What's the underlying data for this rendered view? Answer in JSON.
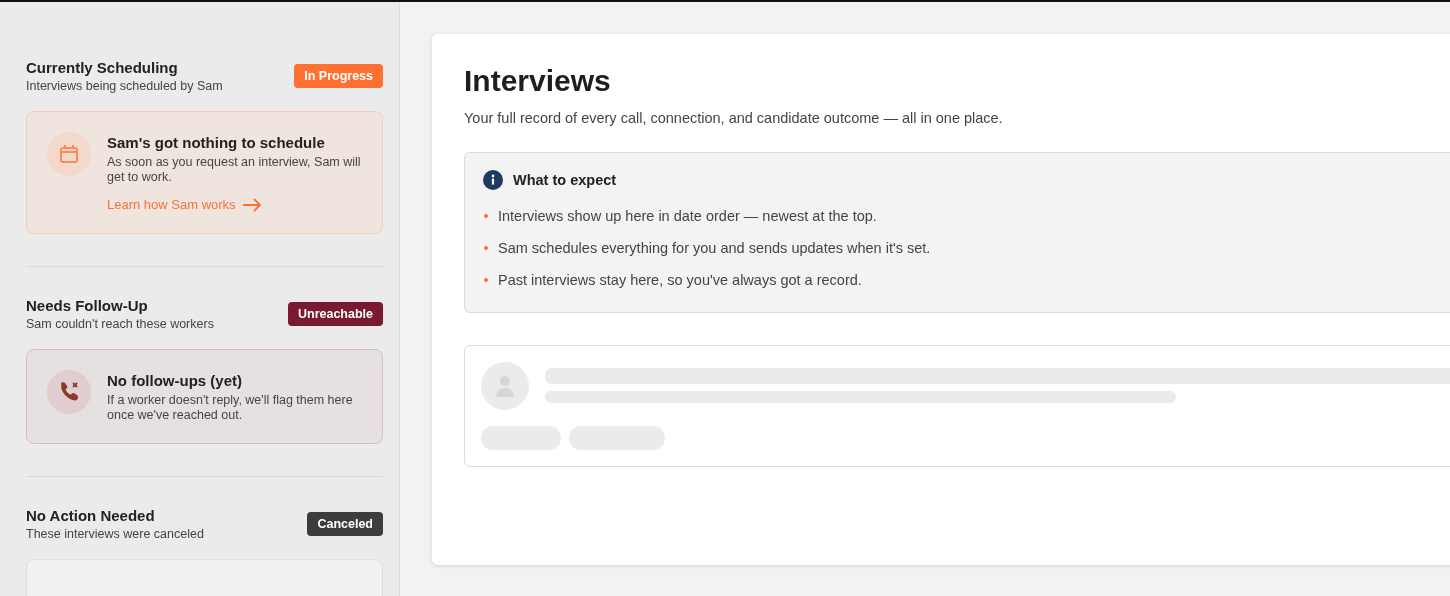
{
  "sidebar": {
    "sections": [
      {
        "kind": "in_progress",
        "title": "Currently Scheduling",
        "subtitle": "Interviews being scheduled by Sam",
        "badge": "In Progress",
        "empty_state": {
          "title": "Sam's got nothing to schedule",
          "text": "As soon as you request an interview, Sam will get to work.",
          "link": "Learn how Sam works"
        }
      },
      {
        "kind": "unreachable",
        "title": "Needs Follow-Up",
        "subtitle": "Sam couldn't reach these workers",
        "badge": "Unreachable",
        "empty_state": {
          "title": "No follow-ups (yet)",
          "text": "If a worker doesn't reply, we'll flag them here once we've reached out."
        }
      },
      {
        "kind": "canceled",
        "title": "No Action Needed",
        "subtitle": "These interviews were canceled",
        "badge": "Canceled"
      }
    ]
  },
  "main": {
    "title": "Interviews",
    "subtitle": "Your full record of every call, connection, and candidate outcome — all in one place.",
    "info": {
      "title": "What to expect",
      "items": [
        "Interviews show up here in date order — newest at the top.",
        "Sam schedules everything for you and sends updates when it's set.",
        "Past interviews stay here, so you've always got a record."
      ]
    }
  }
}
